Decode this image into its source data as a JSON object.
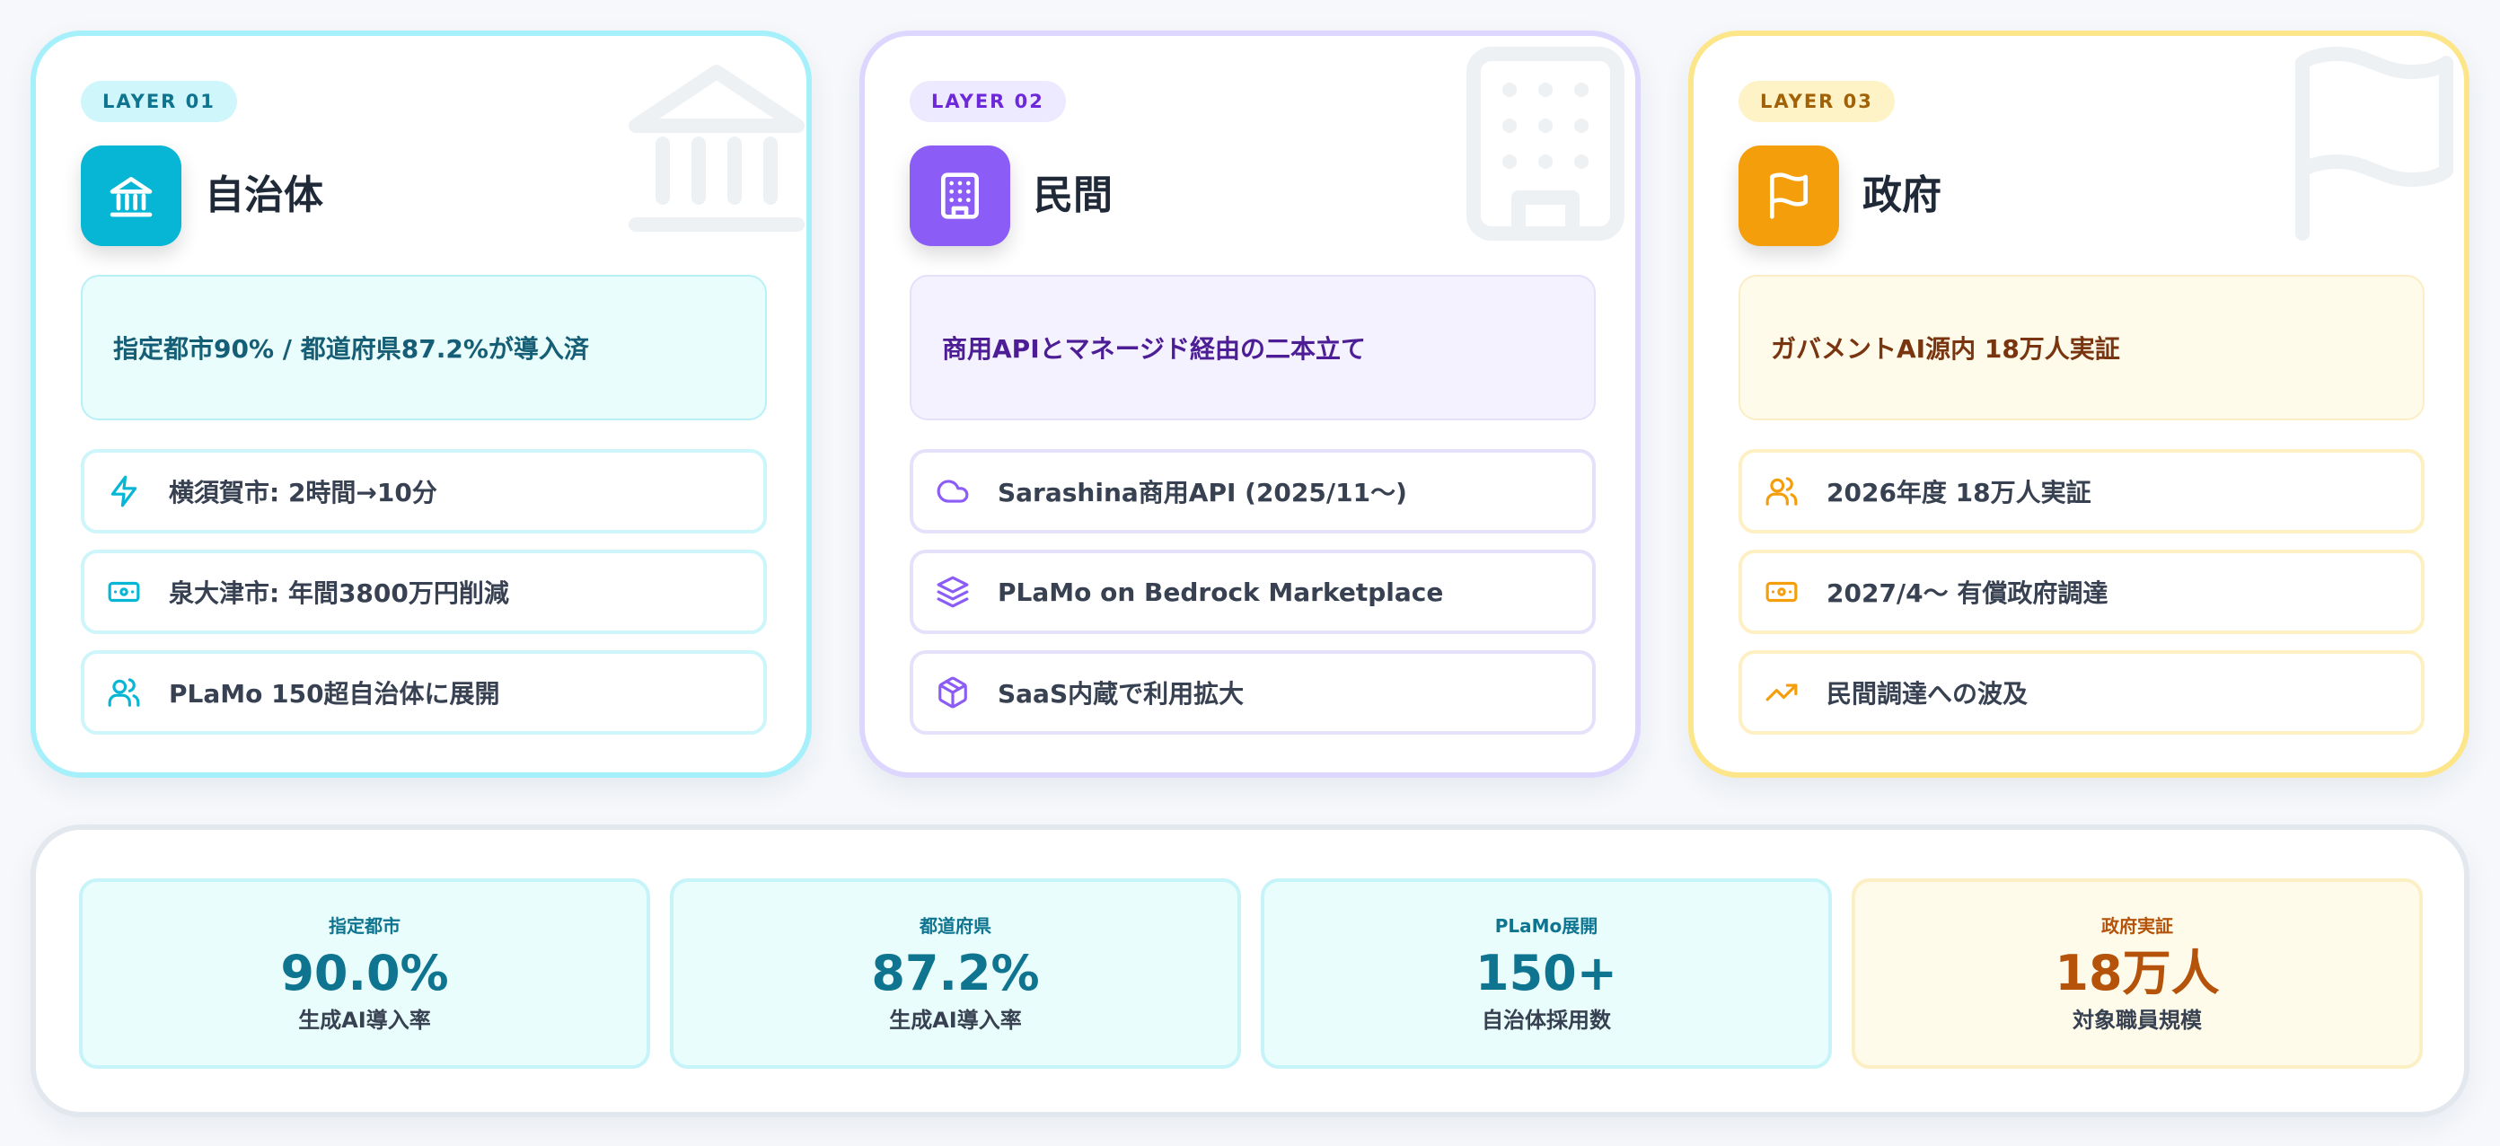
{
  "layers": [
    {
      "pill": "LAYER 01",
      "title": "自治体",
      "icon": "landmark-icon",
      "highlight": "指定都市90% / 都道府県87.2%が導入済",
      "items": [
        {
          "icon": "zap-icon",
          "text": "横須賀市: 2時間→10分"
        },
        {
          "icon": "banknote-icon",
          "text": "泉大津市: 年間3800万円削減"
        },
        {
          "icon": "users-icon",
          "text": "PLaMo 150超自治体に展開"
        }
      ]
    },
    {
      "pill": "LAYER 02",
      "title": "民間",
      "icon": "building-icon",
      "highlight": "商用APIとマネージド経由の二本立て",
      "items": [
        {
          "icon": "cloud-icon",
          "text": "Sarashina商用API (2025/11〜)"
        },
        {
          "icon": "layers-icon",
          "text": "PLaMo on Bedrock Marketplace"
        },
        {
          "icon": "package-icon",
          "text": "SaaS内蔵で利用拡大"
        }
      ]
    },
    {
      "pill": "LAYER 03",
      "title": "政府",
      "icon": "flag-icon",
      "highlight": "ガバメントAI源内 18万人実証",
      "items": [
        {
          "icon": "users-icon",
          "text": "2026年度 18万人実証"
        },
        {
          "icon": "banknote-icon",
          "text": "2027/4〜 有償政府調達"
        },
        {
          "icon": "trending-up-icon",
          "text": "民間調達への波及"
        }
      ]
    }
  ],
  "stats": [
    {
      "label": "指定都市",
      "value": "90.0%",
      "sub": "生成AI導入率"
    },
    {
      "label": "都道府県",
      "value": "87.2%",
      "sub": "生成AI導入率"
    },
    {
      "label": "PLaMo展開",
      "value": "150+",
      "sub": "自治体採用数"
    },
    {
      "label": "政府実証",
      "value": "18万人",
      "sub": "対象職員規模"
    }
  ],
  "colors": {
    "cyan": "#06b6d4",
    "violet": "#8b5cf6",
    "amber": "#f59e0b"
  }
}
